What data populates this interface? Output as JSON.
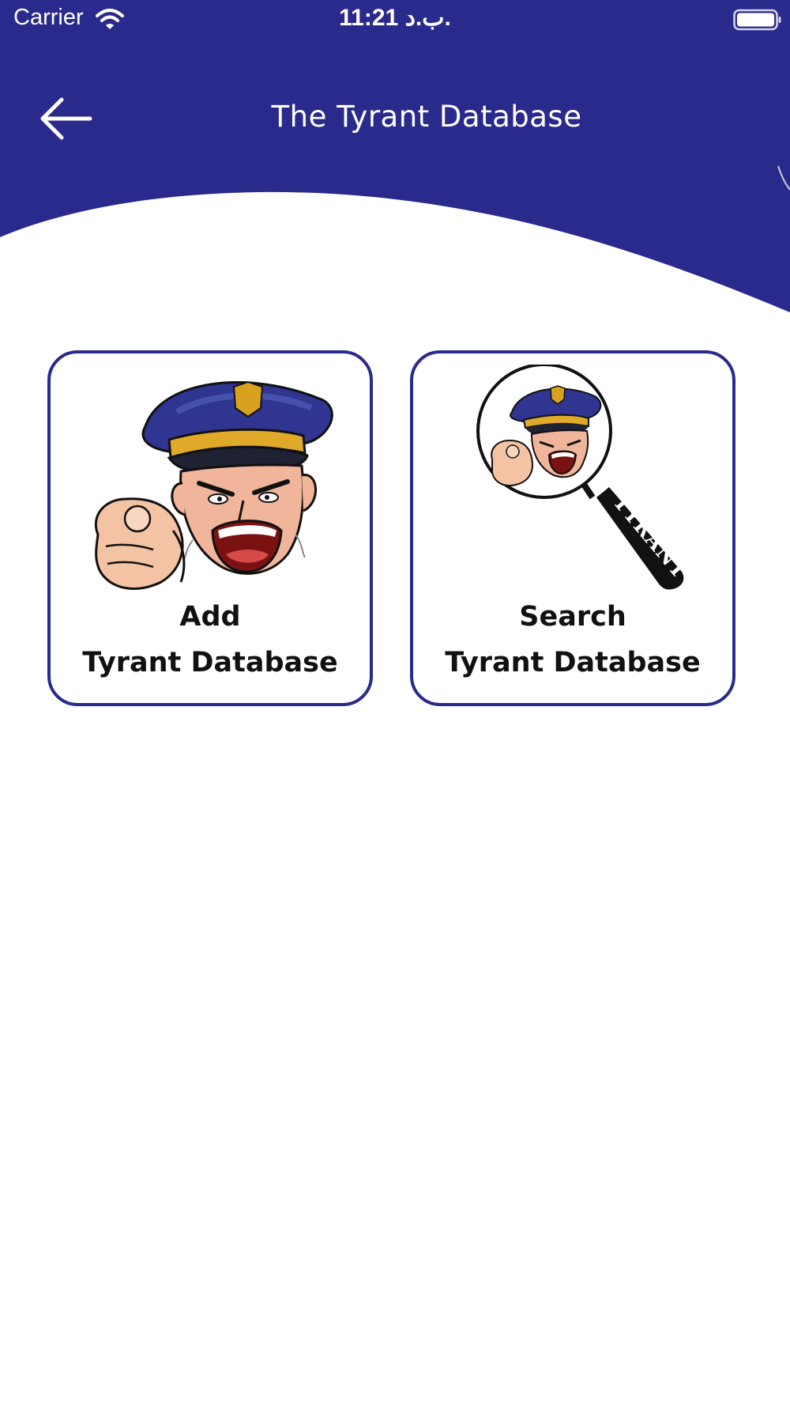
{
  "status_bar": {
    "carrier": "Carrier",
    "time": "11:21 ب.د.",
    "wifi_icon": "wifi-icon",
    "battery_icon": "battery-icon"
  },
  "nav": {
    "title": "The Tyrant Database",
    "back_icon": "arrow-left-icon"
  },
  "cards": [
    {
      "line1": "Add",
      "line2": "Tyrant Database",
      "icon": "shouting-police-officer-icon"
    },
    {
      "line1": "Search",
      "line2": "Tyrant Database",
      "icon": "magnifying-glass-tyrant-icon",
      "handle_text": "TYRANT"
    }
  ],
  "colors": {
    "header": "#2a2a8c",
    "card_border": "#2a2a8c",
    "background": "#ffffff",
    "text": "#111111"
  }
}
